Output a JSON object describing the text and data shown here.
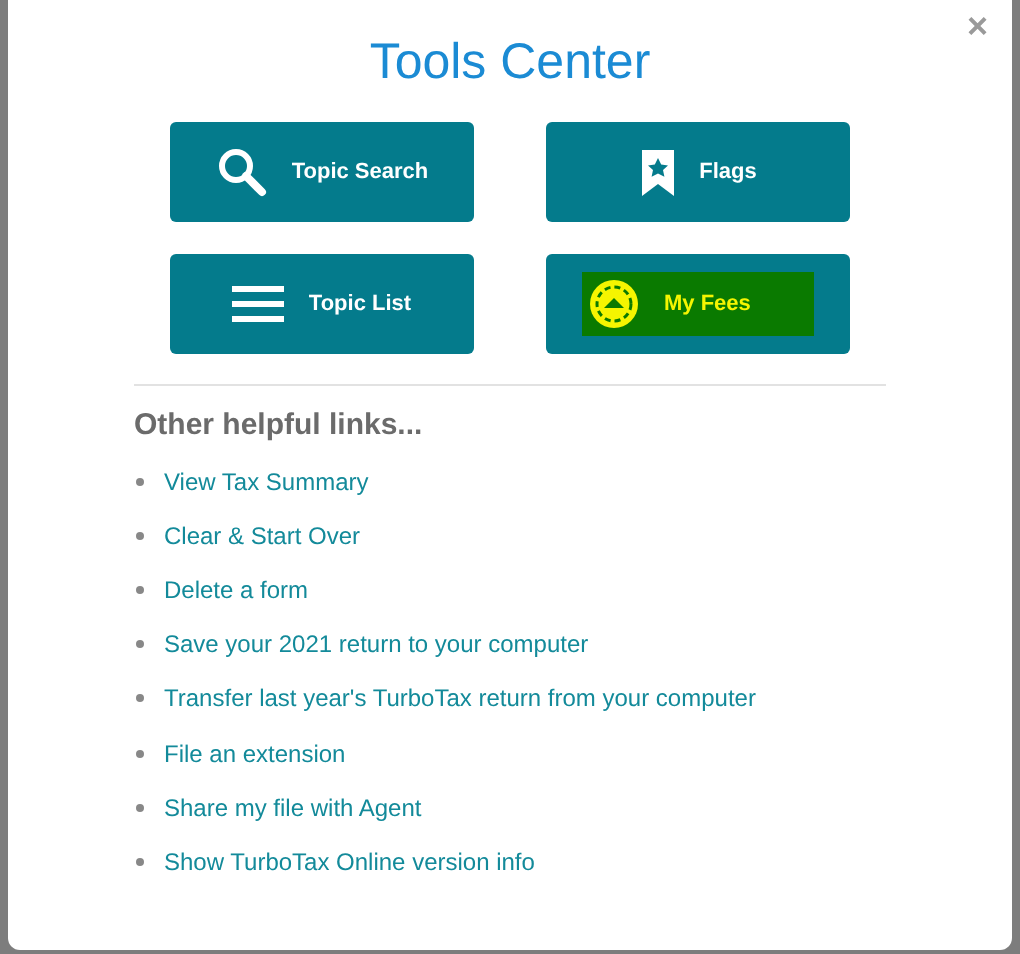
{
  "dialog": {
    "title": "Tools Center",
    "close": "×"
  },
  "tools": [
    {
      "label": "Topic Search",
      "kind": "search",
      "highlighted": false
    },
    {
      "label": "Flags",
      "kind": "flag",
      "highlighted": false
    },
    {
      "label": "Topic List",
      "kind": "list",
      "highlighted": false
    },
    {
      "label": "My Fees",
      "kind": "coin",
      "highlighted": true
    }
  ],
  "links_heading": "Other helpful links...",
  "links": [
    "View Tax Summary",
    "Clear & Start Over",
    "Delete a form",
    "Save your 2021 return to your computer",
    "Transfer last year's TurboTax return from your computer",
    "File an extension",
    "Share my file with Agent",
    "Show TurboTax Online version info"
  ]
}
